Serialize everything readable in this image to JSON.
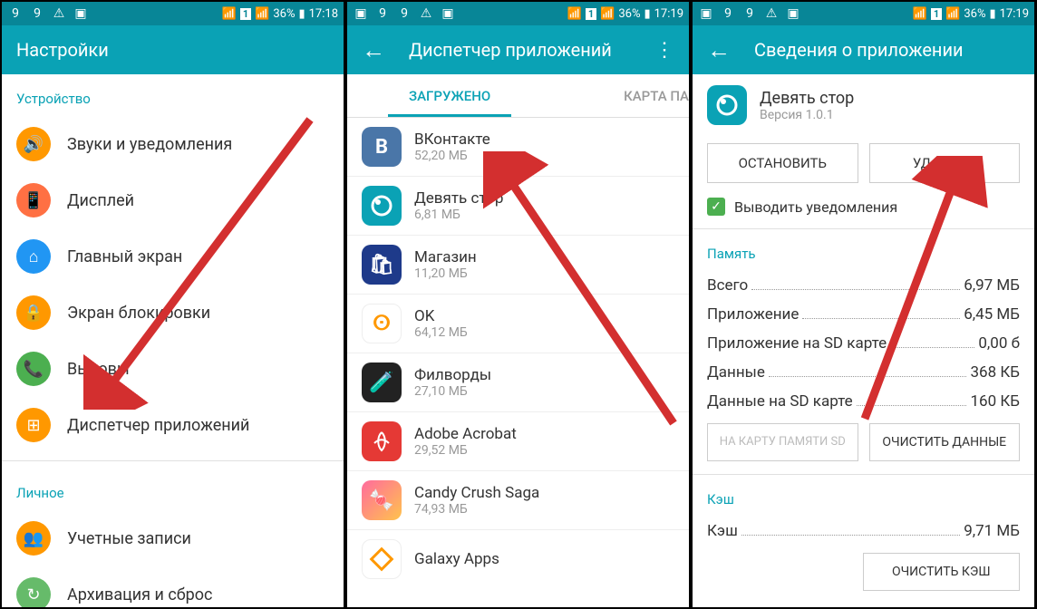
{
  "screen1": {
    "statusbar": {
      "battery": "36%",
      "time": "17:18",
      "sim": "1"
    },
    "title": "Настройки",
    "section_device": "Устройство",
    "items": [
      {
        "label": "Звуки и уведомления"
      },
      {
        "label": "Дисплей"
      },
      {
        "label": "Главный экран"
      },
      {
        "label": "Экран блокировки"
      },
      {
        "label": "Вызовы"
      },
      {
        "label": "Диспетчер приложений"
      }
    ],
    "section_personal": "Личное",
    "items2": [
      {
        "label": "Учетные записи"
      },
      {
        "label": "Архивация и сброс"
      }
    ]
  },
  "screen2": {
    "statusbar": {
      "battery": "36%",
      "time": "17:19",
      "sim": "1"
    },
    "title": "Диспетчер приложений",
    "tab_active": "ЗАГРУЖЕНО",
    "tab_partial": "КАРТА ПА",
    "apps": [
      {
        "name": "ВКонтакте",
        "size": "52,20 МБ",
        "bg": "#4a76a8",
        "letter": "В"
      },
      {
        "name": "Девять стор",
        "size": "6,81 МБ",
        "bg": "#0aa2b5",
        "letter": "9"
      },
      {
        "name": "Магазин",
        "size": "11,20 МБ",
        "bg": "#1e3a8a",
        "letter": "↓"
      },
      {
        "name": "OK",
        "size": "64,12 МБ",
        "bg": "#fff",
        "letter": ""
      },
      {
        "name": "Филворды",
        "size": "27,10 МБ",
        "bg": "#222",
        "letter": ""
      },
      {
        "name": "Adobe Acrobat",
        "size": "29,52 МБ",
        "bg": "#e53935",
        "letter": ""
      },
      {
        "name": "Candy Crush Saga",
        "size": "74,93 МБ",
        "bg": "#fff",
        "letter": ""
      },
      {
        "name": "Galaxy Apps",
        "size": "",
        "bg": "#fff",
        "letter": ""
      }
    ]
  },
  "screen3": {
    "statusbar": {
      "battery": "36%",
      "time": "17:19",
      "sim": "1"
    },
    "title": "Сведения о приложении",
    "app_name": "Девять стор",
    "app_version": "Версия 1.0.1",
    "btn_stop": "ОСТАНОВИТЬ",
    "btn_delete": "УДАЛИТЬ",
    "checkbox_label": "Выводить уведомления",
    "section_memory": "Память",
    "rows": [
      {
        "label": "Всего",
        "value": "6,97 МБ"
      },
      {
        "label": "Приложение",
        "value": "6,45 МБ"
      },
      {
        "label": "Приложение на SD карте",
        "value": "0,00 б"
      },
      {
        "label": "Данные",
        "value": "368 КБ"
      },
      {
        "label": "Данные на SD карте",
        "value": "160 КБ"
      }
    ],
    "btn_sd": "НА КАРТУ ПАМЯТИ SD",
    "btn_clear": "ОЧИСТИТЬ ДАННЫЕ",
    "section_cache": "Кэш",
    "cache_label": "Кэш",
    "cache_value": "9,71 МБ",
    "btn_clear_cache": "ОЧИСТИТЬ КЭШ"
  }
}
